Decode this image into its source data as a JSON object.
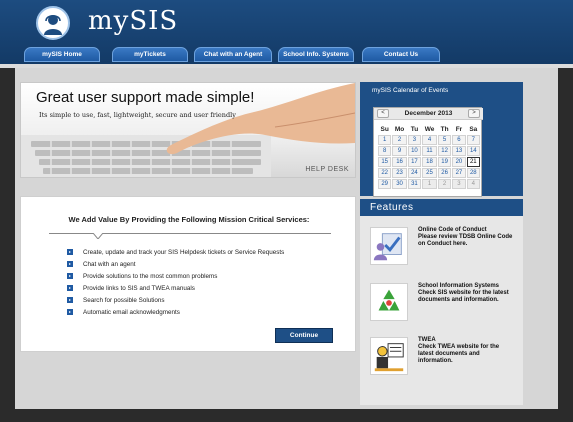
{
  "app": {
    "logo_text": "mySIS"
  },
  "nav": {
    "items": [
      {
        "label": "mySIS Home"
      },
      {
        "label": "myTickets"
      },
      {
        "label": "Chat with an Agent"
      },
      {
        "label": "School Info. Systems"
      },
      {
        "label": "Contact Us"
      }
    ]
  },
  "hero": {
    "title": "Great user support made simple!",
    "subtitle": "Its simple to use, fast, lightweight, secure and user friendly",
    "caption": "HELP DESK"
  },
  "calendar": {
    "title": "mySIS Calendar of Events",
    "month": "December 2013",
    "prev_label": "<",
    "next_label": ">",
    "weekdays": [
      "Su",
      "Mo",
      "Tu",
      "We",
      "Th",
      "Fr",
      "Sa"
    ],
    "weeks": [
      [
        "1",
        "2",
        "3",
        "4",
        "5",
        "6",
        "7"
      ],
      [
        "8",
        "9",
        "10",
        "11",
        "12",
        "13",
        "14"
      ],
      [
        "15",
        "16",
        "17",
        "18",
        "19",
        "20",
        "21"
      ],
      [
        "22",
        "23",
        "24",
        "25",
        "26",
        "27",
        "28"
      ],
      [
        "29",
        "30",
        "31",
        "1",
        "2",
        "3",
        "4"
      ]
    ],
    "today": "21"
  },
  "features": {
    "heading": "Features",
    "items": [
      {
        "icon": "conduct-icon",
        "line1": "Online Code of Conduct",
        "line2": "Please review TDSB Online Code on Conduct here."
      },
      {
        "icon": "recycle-icon",
        "line1": "School Information Systems",
        "line2": "Check SIS website for the latest documents and information."
      },
      {
        "icon": "twea-icon",
        "line1": "TWEA",
        "line2": "Check TWEA website for the latest documents and information."
      }
    ]
  },
  "services": {
    "title": "We Add Value By Providing the Following Mission Critical Services:",
    "items": [
      "Create, update and track your SIS Helpdesk tickets or Service Requests",
      "Chat with an agent",
      "Provide solutions to the most common problems",
      "Provide links to SIS and TWEA manuals",
      "Search for possible Solutions",
      "Automatic email acknowledgments"
    ],
    "continue_label": "Continue"
  },
  "colors": {
    "brand": "#1e4f86",
    "accent": "#1f5aa3"
  }
}
